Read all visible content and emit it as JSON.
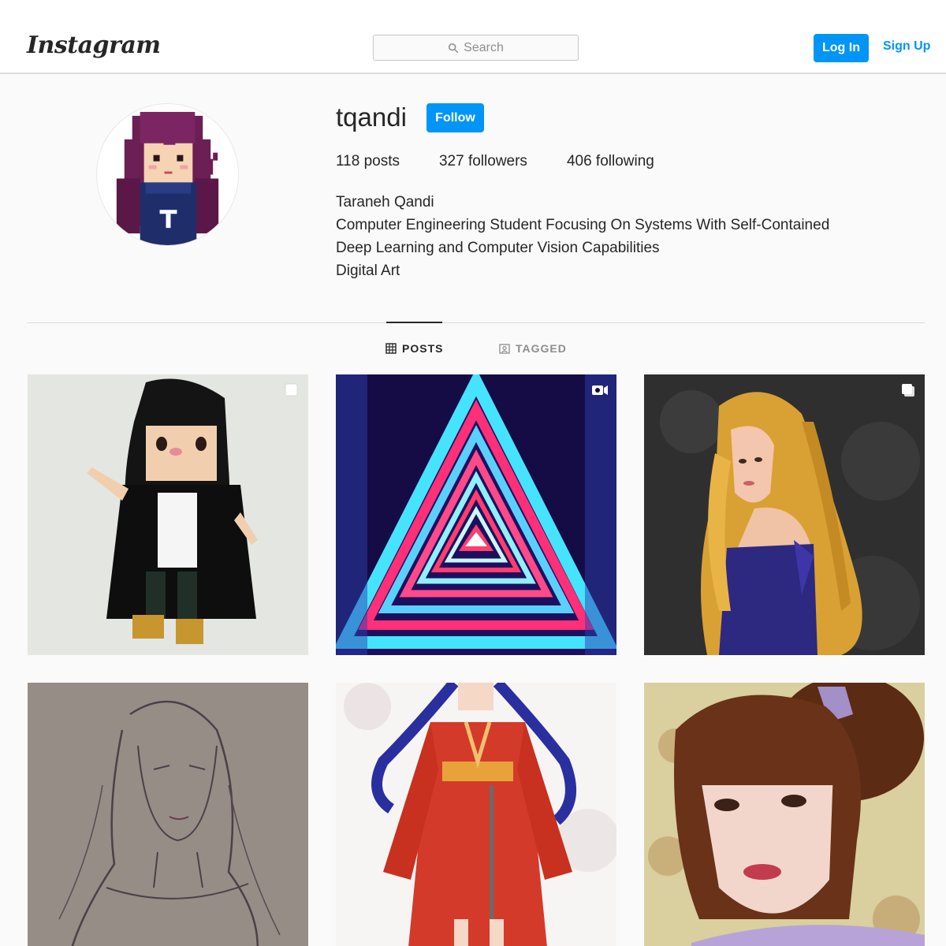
{
  "header": {
    "logo_text": "Instagram",
    "search_placeholder": "Search",
    "login_label": "Log In",
    "signup_label": "Sign Up"
  },
  "profile": {
    "username": "tqandi",
    "follow_label": "Follow",
    "stats": {
      "posts": "118 posts",
      "followers": "327 followers",
      "following": "406 following"
    },
    "bio": {
      "name": "Taraneh Qandi",
      "line1": "Computer Engineering Student Focusing On Systems With Self-Contained",
      "line2": "Deep Learning and Computer Vision Capabilities",
      "line3": "Digital Art"
    }
  },
  "tabs": {
    "posts": "POSTS",
    "tagged": "TAGGED"
  },
  "colors": {
    "accent": "#0095f6",
    "border": "#dbdbdb",
    "text": "#262626",
    "muted": "#8e8e8e"
  }
}
